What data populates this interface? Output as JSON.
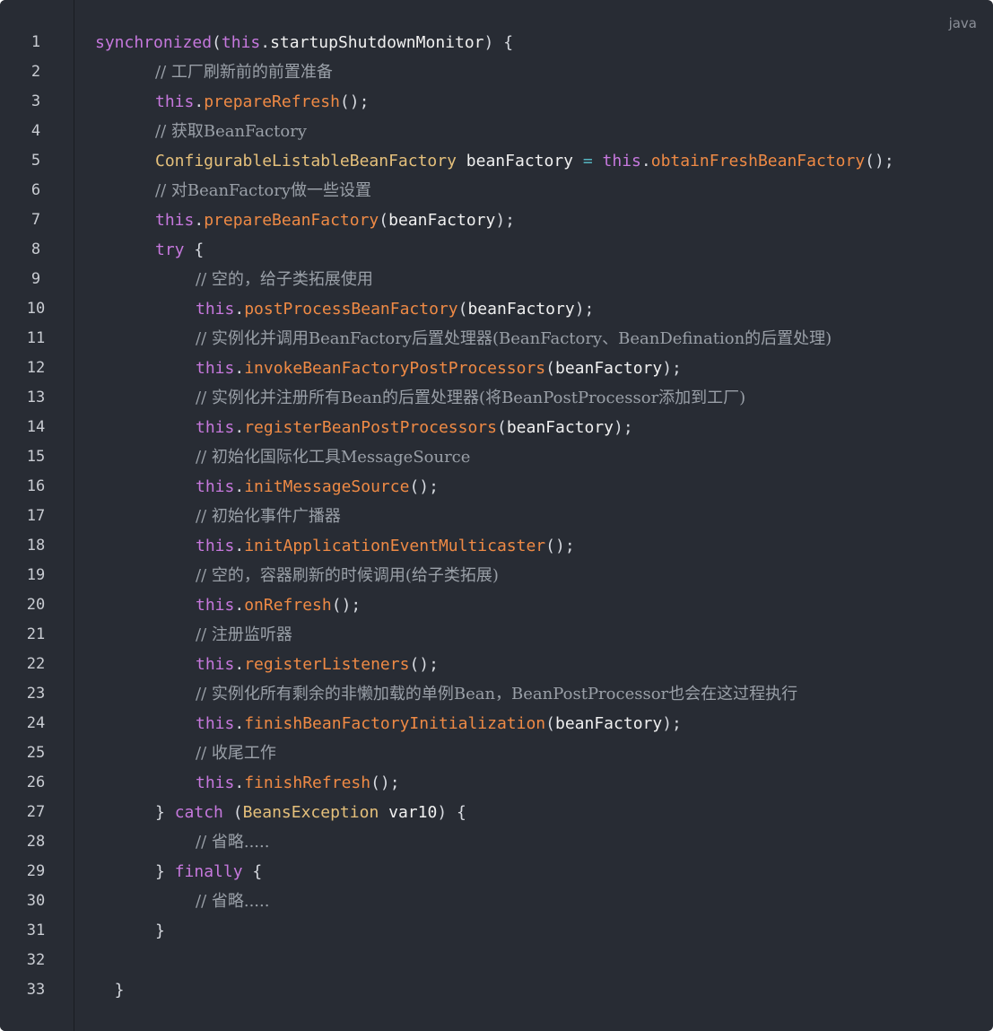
{
  "language_label": "java",
  "lines": [
    {
      "num": "1",
      "indent": 0,
      "tokens": [
        [
          "kw",
          "synchronized"
        ],
        [
          "punc",
          "("
        ],
        [
          "kw",
          "this"
        ],
        [
          "punc",
          "."
        ],
        [
          "var",
          "startupShutdownMonitor"
        ],
        [
          "punc",
          ") {"
        ]
      ]
    },
    {
      "num": "2",
      "indent": 1,
      "tokens": [
        [
          "cm",
          "// 工厂刷新前的前置准备"
        ]
      ]
    },
    {
      "num": "3",
      "indent": 1,
      "tokens": [
        [
          "kw",
          "this"
        ],
        [
          "punc",
          "."
        ],
        [
          "fn",
          "prepareRefresh"
        ],
        [
          "punc",
          "();"
        ]
      ]
    },
    {
      "num": "4",
      "indent": 1,
      "tokens": [
        [
          "cm",
          "// 获取BeanFactory"
        ]
      ]
    },
    {
      "num": "5",
      "indent": 1,
      "tokens": [
        [
          "type",
          "ConfigurableListableBeanFactory"
        ],
        [
          "punc",
          " "
        ],
        [
          "var",
          "beanFactory"
        ],
        [
          "punc",
          " "
        ],
        [
          "op",
          "="
        ],
        [
          "punc",
          " "
        ],
        [
          "kw",
          "this"
        ],
        [
          "punc",
          "."
        ],
        [
          "fn",
          "obtainFreshBeanFactory"
        ],
        [
          "punc",
          "();"
        ]
      ]
    },
    {
      "num": "6",
      "indent": 1,
      "tokens": [
        [
          "cm",
          "// 对BeanFactory做一些设置"
        ]
      ]
    },
    {
      "num": "7",
      "indent": 1,
      "tokens": [
        [
          "kw",
          "this"
        ],
        [
          "punc",
          "."
        ],
        [
          "fn",
          "prepareBeanFactory"
        ],
        [
          "punc",
          "("
        ],
        [
          "var",
          "beanFactory"
        ],
        [
          "punc",
          ");"
        ]
      ]
    },
    {
      "num": "8",
      "indent": 1,
      "tokens": [
        [
          "kw",
          "try"
        ],
        [
          "punc",
          " {"
        ]
      ]
    },
    {
      "num": "9",
      "indent": 2,
      "tokens": [
        [
          "cm",
          "// 空的，给子类拓展使用"
        ]
      ]
    },
    {
      "num": "10",
      "indent": 2,
      "tokens": [
        [
          "kw",
          "this"
        ],
        [
          "punc",
          "."
        ],
        [
          "fn",
          "postProcessBeanFactory"
        ],
        [
          "punc",
          "("
        ],
        [
          "var",
          "beanFactory"
        ],
        [
          "punc",
          ");"
        ]
      ]
    },
    {
      "num": "11",
      "indent": 2,
      "tokens": [
        [
          "cm",
          "// 实例化并调用BeanFactory后置处理器(BeanFactory、BeanDefination的后置处理)"
        ]
      ]
    },
    {
      "num": "12",
      "indent": 2,
      "tokens": [
        [
          "kw",
          "this"
        ],
        [
          "punc",
          "."
        ],
        [
          "fn",
          "invokeBeanFactoryPostProcessors"
        ],
        [
          "punc",
          "("
        ],
        [
          "var",
          "beanFactory"
        ],
        [
          "punc",
          ");"
        ]
      ]
    },
    {
      "num": "13",
      "indent": 2,
      "tokens": [
        [
          "cm",
          "// 实例化并注册所有Bean的后置处理器(将BeanPostProcessor添加到工厂)"
        ]
      ]
    },
    {
      "num": "14",
      "indent": 2,
      "tokens": [
        [
          "kw",
          "this"
        ],
        [
          "punc",
          "."
        ],
        [
          "fn",
          "registerBeanPostProcessors"
        ],
        [
          "punc",
          "("
        ],
        [
          "var",
          "beanFactory"
        ],
        [
          "punc",
          ");"
        ]
      ]
    },
    {
      "num": "15",
      "indent": 2,
      "tokens": [
        [
          "cm",
          "// 初始化国际化工具MessageSource"
        ]
      ]
    },
    {
      "num": "16",
      "indent": 2,
      "tokens": [
        [
          "kw",
          "this"
        ],
        [
          "punc",
          "."
        ],
        [
          "fn",
          "initMessageSource"
        ],
        [
          "punc",
          "();"
        ]
      ]
    },
    {
      "num": "17",
      "indent": 2,
      "tokens": [
        [
          "cm",
          "// 初始化事件广播器"
        ]
      ]
    },
    {
      "num": "18",
      "indent": 2,
      "tokens": [
        [
          "kw",
          "this"
        ],
        [
          "punc",
          "."
        ],
        [
          "fn",
          "initApplicationEventMulticaster"
        ],
        [
          "punc",
          "();"
        ]
      ]
    },
    {
      "num": "19",
      "indent": 2,
      "tokens": [
        [
          "cm",
          "// 空的，容器刷新的时候调用(给子类拓展)"
        ]
      ]
    },
    {
      "num": "20",
      "indent": 2,
      "tokens": [
        [
          "kw",
          "this"
        ],
        [
          "punc",
          "."
        ],
        [
          "fn",
          "onRefresh"
        ],
        [
          "punc",
          "();"
        ]
      ]
    },
    {
      "num": "21",
      "indent": 2,
      "tokens": [
        [
          "cm",
          "// 注册监听器"
        ]
      ]
    },
    {
      "num": "22",
      "indent": 2,
      "tokens": [
        [
          "kw",
          "this"
        ],
        [
          "punc",
          "."
        ],
        [
          "fn",
          "registerListeners"
        ],
        [
          "punc",
          "();"
        ]
      ]
    },
    {
      "num": "23",
      "indent": 2,
      "tokens": [
        [
          "cm",
          "// 实例化所有剩余的非懒加载的单例Bean，BeanPostProcessor也会在这过程执行"
        ]
      ]
    },
    {
      "num": "24",
      "indent": 2,
      "tokens": [
        [
          "kw",
          "this"
        ],
        [
          "punc",
          "."
        ],
        [
          "fn",
          "finishBeanFactoryInitialization"
        ],
        [
          "punc",
          "("
        ],
        [
          "var",
          "beanFactory"
        ],
        [
          "punc",
          ");"
        ]
      ]
    },
    {
      "num": "25",
      "indent": 2,
      "tokens": [
        [
          "cm",
          "// 收尾工作"
        ]
      ]
    },
    {
      "num": "26",
      "indent": 2,
      "tokens": [
        [
          "kw",
          "this"
        ],
        [
          "punc",
          "."
        ],
        [
          "fn",
          "finishRefresh"
        ],
        [
          "punc",
          "();"
        ]
      ]
    },
    {
      "num": "27",
      "indent": 1,
      "tokens": [
        [
          "punc",
          "} "
        ],
        [
          "kw",
          "catch"
        ],
        [
          "punc",
          " ("
        ],
        [
          "type",
          "BeansException"
        ],
        [
          "punc",
          " "
        ],
        [
          "var",
          "var10"
        ],
        [
          "punc",
          ") {"
        ]
      ]
    },
    {
      "num": "28",
      "indent": 2,
      "tokens": [
        [
          "cm",
          "// 省略....."
        ]
      ]
    },
    {
      "num": "29",
      "indent": 1,
      "tokens": [
        [
          "punc",
          "} "
        ],
        [
          "kw",
          "finally"
        ],
        [
          "punc",
          " {"
        ]
      ]
    },
    {
      "num": "30",
      "indent": 2,
      "tokens": [
        [
          "cm",
          "// 省略....."
        ]
      ]
    },
    {
      "num": "31",
      "indent": 1,
      "tokens": [
        [
          "punc",
          "}"
        ]
      ]
    },
    {
      "num": "32",
      "indent": 0,
      "tokens": []
    },
    {
      "num": "33",
      "indent": 0,
      "tokens": [
        [
          "punc",
          "  }"
        ]
      ]
    }
  ]
}
